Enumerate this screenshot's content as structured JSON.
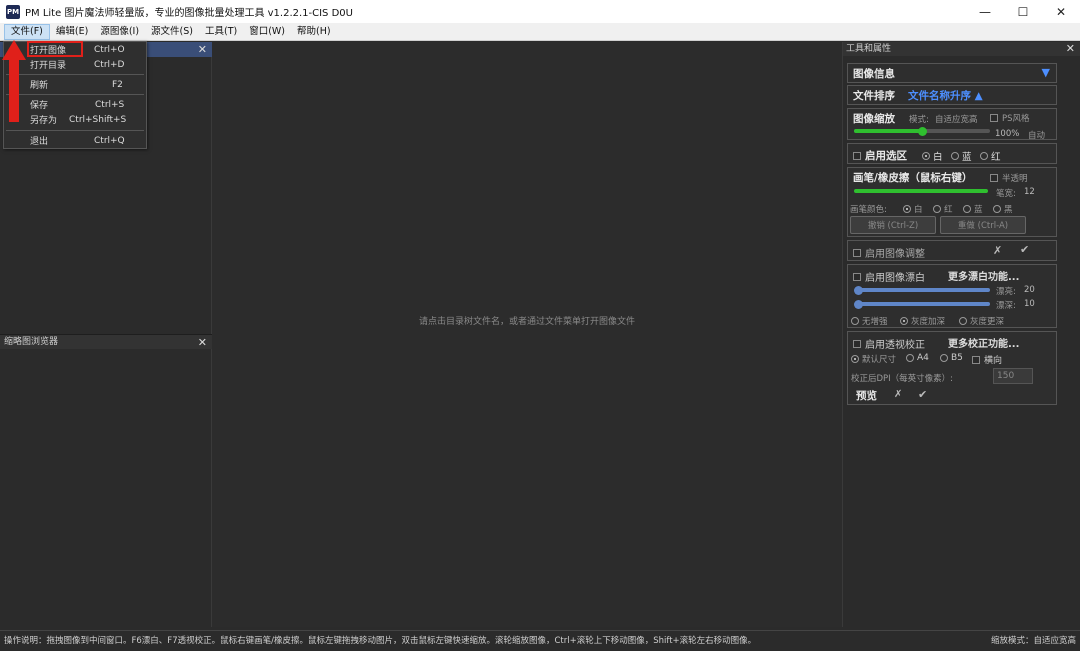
{
  "window": {
    "icon_text": "PM",
    "title": "PM Lite 图片魔法师轻量版，专业的图像批量处理工具 v1.2.2.1-CIS D0U",
    "controls": [
      "—",
      "☐",
      "✕"
    ]
  },
  "menu": {
    "items": [
      "文件(F)",
      "编辑(E)",
      "源图像(I)",
      "源文件(S)",
      "工具(T)",
      "窗口(W)",
      "帮助(H)"
    ]
  },
  "file_menu": {
    "items": [
      {
        "label": "打开图像",
        "shortcut": "Ctrl+O"
      },
      {
        "label": "打开目录",
        "shortcut": "Ctrl+D"
      },
      {
        "label": "刷新",
        "shortcut": "F2"
      },
      {
        "label": "保存",
        "shortcut": "Ctrl+S"
      },
      {
        "label": "另存为",
        "shortcut": "Ctrl+Shift+S"
      },
      {
        "label": "退出",
        "shortcut": "Ctrl+Q"
      }
    ]
  },
  "left": {
    "thumbnail_title": "缩略图浏览器",
    "close": "✕"
  },
  "center": {
    "hint": "请点击目录树文件名，或者通过文件菜单打开图像文件"
  },
  "right": {
    "title": "工具和属性",
    "close": "✕",
    "image_info": {
      "label": "图像信息",
      "arrow": "▼"
    },
    "sort": {
      "label": "文件排序",
      "value": "文件名称升序 ▲"
    },
    "zoom": {
      "label": "图像缩放",
      "mode_label": "模式:",
      "mode_value": "自适应宽高",
      "ps_label": "PS风格",
      "percent": "100%",
      "auto": "自动",
      "level": 0.5
    },
    "selection": {
      "label": "启用选区",
      "options": [
        "白",
        "蓝",
        "红"
      ],
      "selected": 0
    },
    "brush": {
      "label": "画笔/橡皮擦（鼠标右键）",
      "semi_label": "半透明",
      "width_label": "笔宽:",
      "width_value": "12",
      "color_label": "画笔颜色:",
      "colors": [
        "白",
        "红",
        "蓝",
        "黑"
      ],
      "undo": "撤销 (Ctrl-Z)",
      "redo": "重做 (Ctrl-A)"
    },
    "adjust": {
      "label": "启用图像调整",
      "cancel": "✗",
      "ok": "✔"
    },
    "bleach": {
      "label": "启用图像漂白",
      "more": "更多漂白功能...",
      "light_label": "漂亮:",
      "light_value": "20",
      "deep_label": "漂深:",
      "deep_value": "10",
      "options": [
        "无增强",
        "灰度加深",
        "灰度更深"
      ],
      "selected": 1
    },
    "perspective": {
      "label": "启用透视校正",
      "more": "更多校正功能...",
      "sizes": [
        "默认尺寸",
        "A4",
        "B5"
      ],
      "landscape": "横向",
      "dpi_label": "校正后DPI（每英寸像素）:",
      "dpi_value": "150",
      "preview": "预览",
      "cancel": "✗",
      "ok": "✔"
    }
  },
  "status": {
    "help": "操作说明：拖拽图像到中间窗口。F6漂白、F7透视校正。鼠标右键画笔/橡皮擦。鼠标左键拖拽移动图片，双击鼠标左键快速缩放。滚轮缩放图像，Ctrl+滚轮上下移动图像，Shift+滚轮左右移动图像。",
    "zoom_mode": "缩放模式：自适应宽高"
  },
  "colors": {
    "accent_blue": "#4d8fff",
    "slider_green": "#2fbf2f",
    "slider_blue": "#5f86c8",
    "highlight_red": "#e0201a"
  }
}
